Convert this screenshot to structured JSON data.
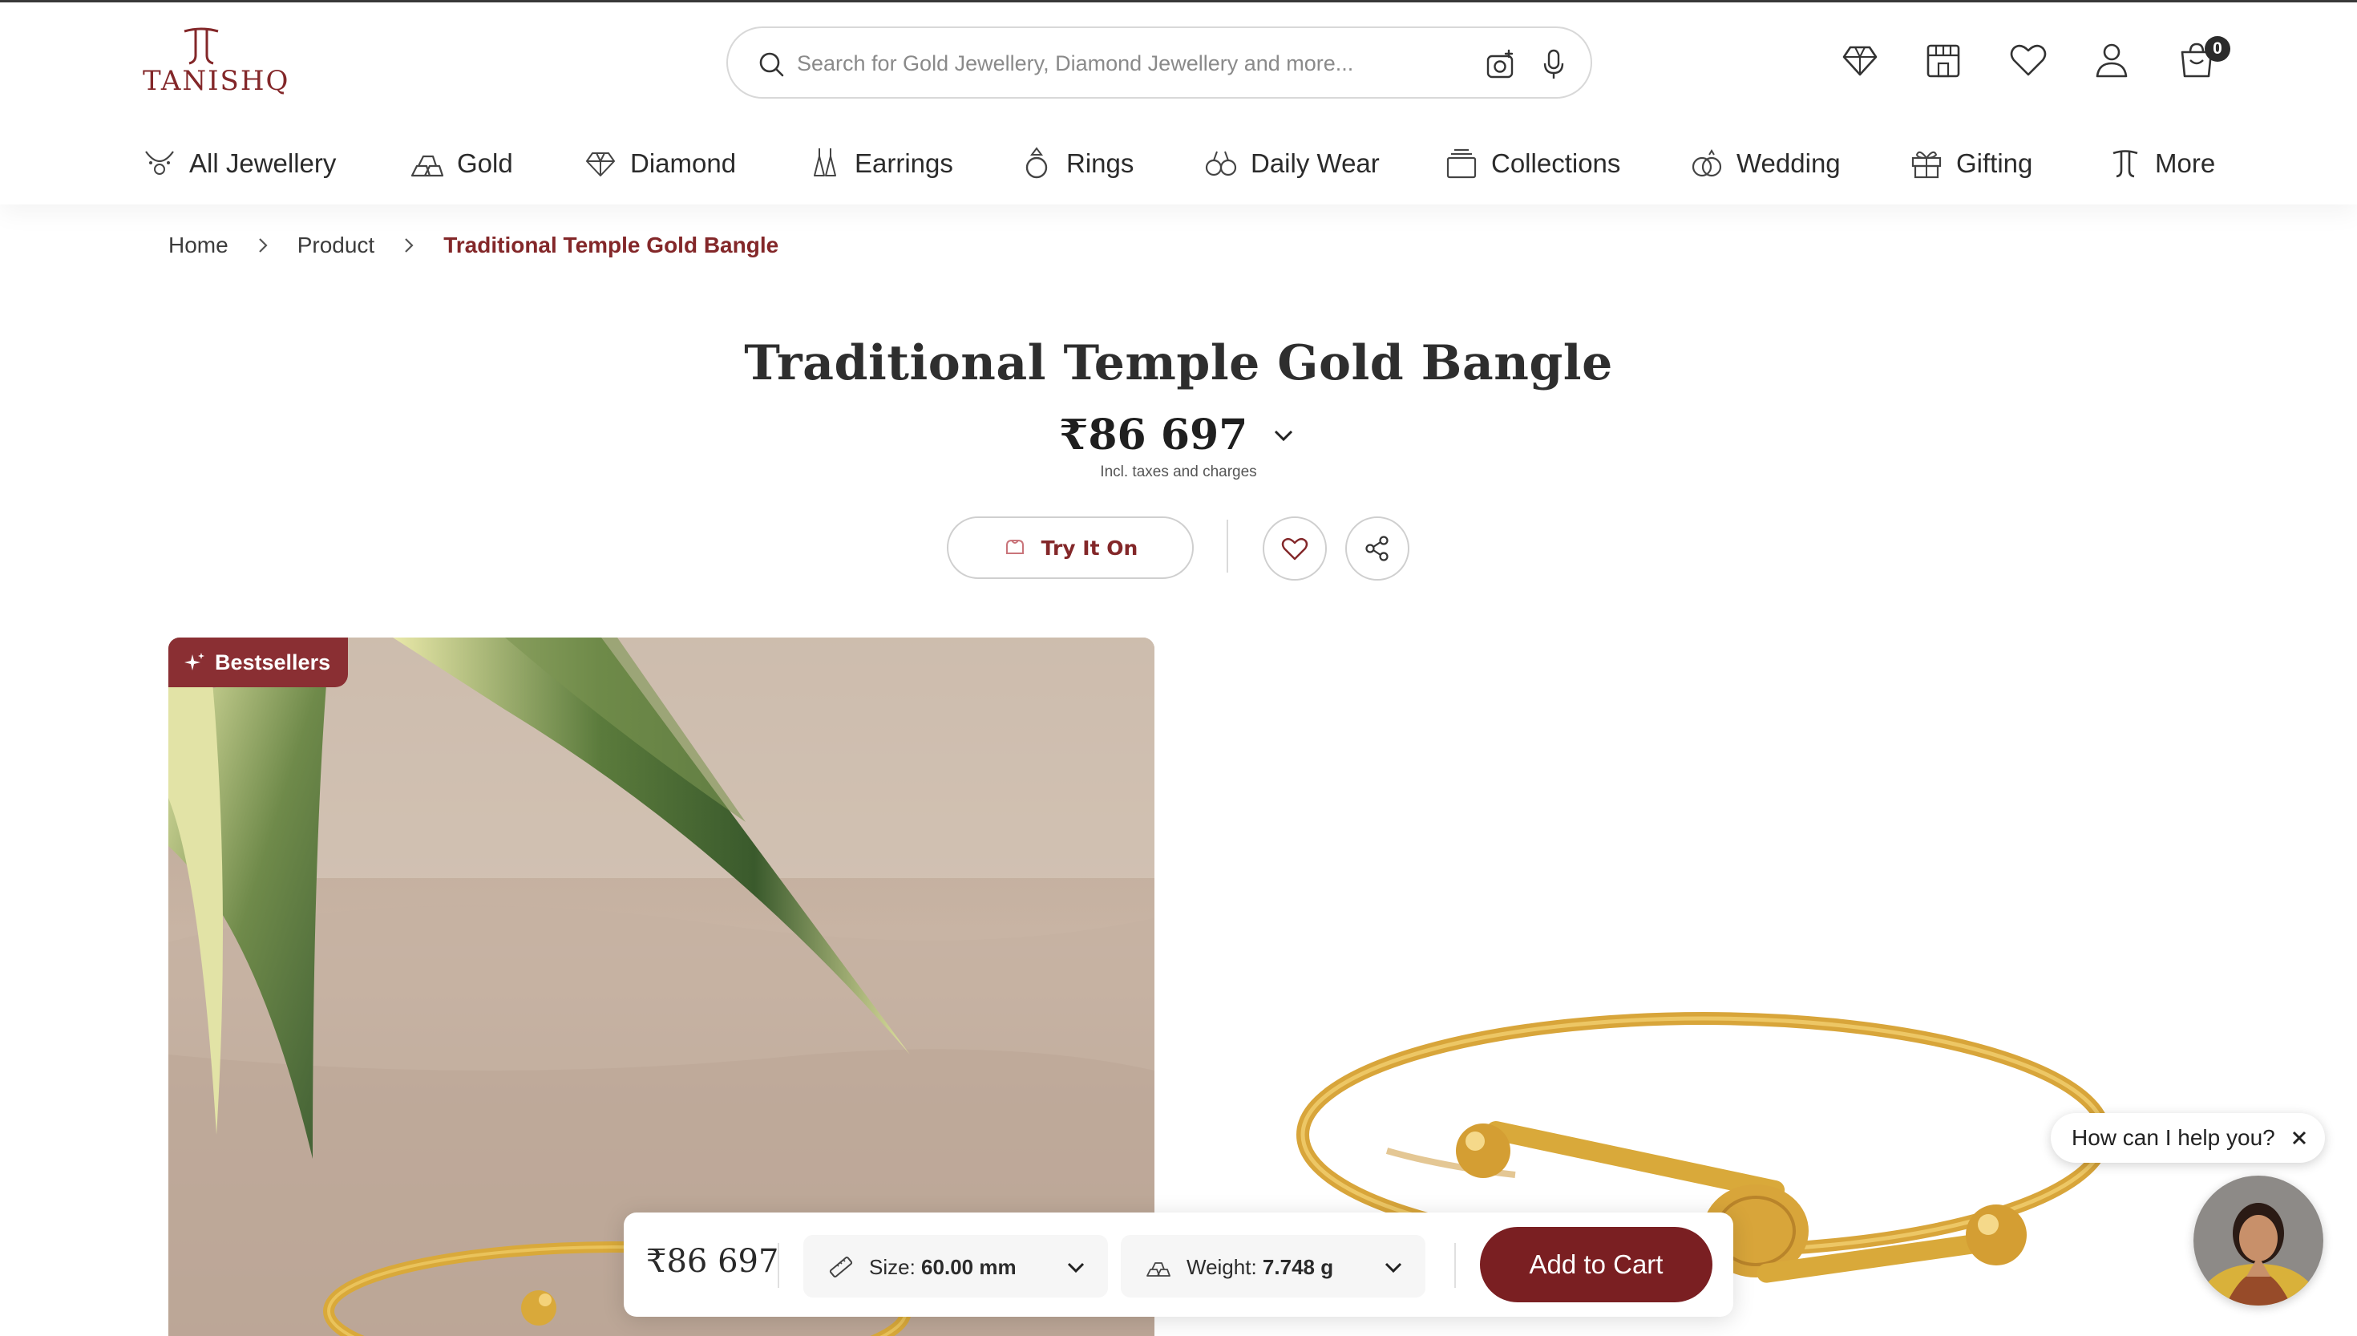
{
  "brand": {
    "name": "TANISHQ",
    "color": "#832729"
  },
  "search": {
    "placeholder": "Search for Gold Jewellery, Diamond Jewellery and more..."
  },
  "header_icons": [
    "diamond-icon",
    "store-icon",
    "wishlist-icon",
    "account-icon",
    "cart-icon"
  ],
  "cart": {
    "count": "0"
  },
  "nav": [
    {
      "label": "All Jewellery",
      "icon": "necklace-icon"
    },
    {
      "label": "Gold",
      "icon": "gold-bars-icon"
    },
    {
      "label": "Diamond",
      "icon": "diamond-icon"
    },
    {
      "label": "Earrings",
      "icon": "earrings-icon"
    },
    {
      "label": "Rings",
      "icon": "ring-icon"
    },
    {
      "label": "Daily Wear",
      "icon": "daily-wear-icon"
    },
    {
      "label": "Collections",
      "icon": "collections-icon"
    },
    {
      "label": "Wedding",
      "icon": "wedding-rings-icon"
    },
    {
      "label": "Gifting",
      "icon": "gift-icon"
    },
    {
      "label": "More",
      "icon": "tanishq-mark-icon"
    }
  ],
  "breadcrumb": [
    "Home",
    "Product",
    "Traditional Temple Gold Bangle"
  ],
  "product": {
    "title": "Traditional Temple Gold Bangle",
    "price": "₹86 697",
    "tax_note": "Incl. taxes and charges",
    "try_on_label": "Try It On",
    "badge": "Bestsellers"
  },
  "sticky_bar": {
    "price": "₹86 697",
    "size_label": "Size:",
    "size_value": "60.00 mm",
    "weight_label": "Weight:",
    "weight_value": "7.748 g",
    "add_to_cart": "Add to Cart"
  },
  "help": {
    "text": "How can I help you?"
  },
  "colors": {
    "accent": "#832729",
    "button": "#7a1f22",
    "badge": "#8a2f33",
    "gold": "#d9a93a"
  }
}
